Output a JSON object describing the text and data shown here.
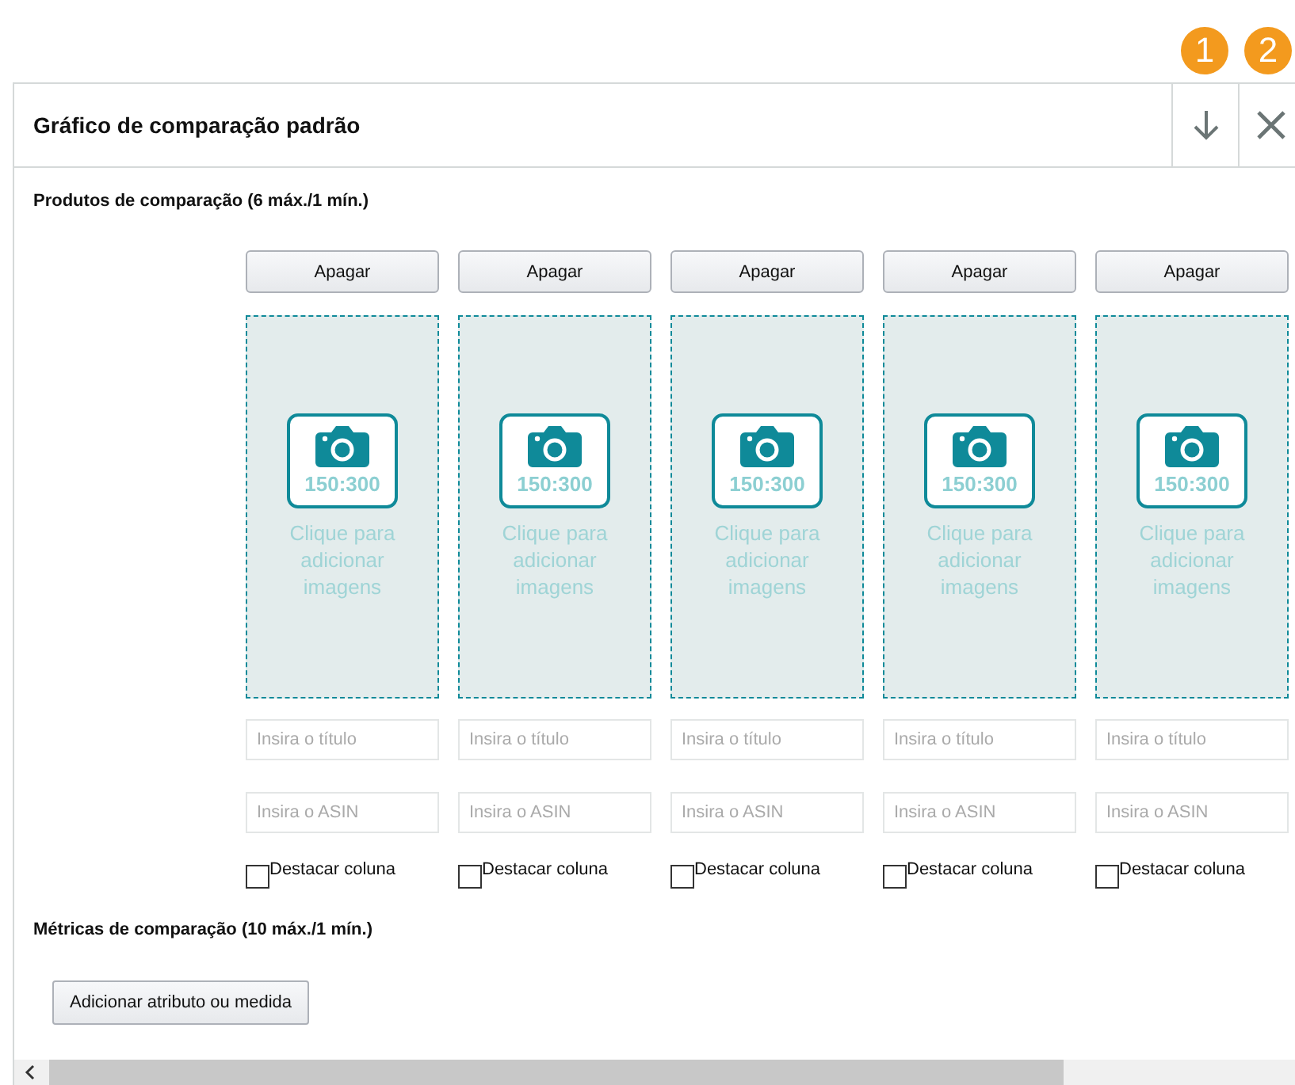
{
  "callouts": [
    "1",
    "2"
  ],
  "dialog": {
    "title": "Gráfico de comparação padrão"
  },
  "products_section": {
    "label": "Produtos de comparação (6 máx./1 mín.)"
  },
  "columns": [
    {
      "delete": "Apagar",
      "ratio": "150:300",
      "hint": "Clique para adicionar imagens",
      "title_placeholder": "Insira o título",
      "asin_placeholder": "Insira o ASIN",
      "highlight": "Destacar coluna",
      "checked": false
    },
    {
      "delete": "Apagar",
      "ratio": "150:300",
      "hint": "Clique para adicionar imagens",
      "title_placeholder": "Insira o título",
      "asin_placeholder": "Insira o ASIN",
      "highlight": "Destacar coluna",
      "checked": false
    },
    {
      "delete": "Apagar",
      "ratio": "150:300",
      "hint": "Clique para adicionar imagens",
      "title_placeholder": "Insira o título",
      "asin_placeholder": "Insira o ASIN",
      "highlight": "Destacar coluna",
      "checked": false
    },
    {
      "delete": "Apagar",
      "ratio": "150:300",
      "hint": "Clique para adicionar imagens",
      "title_placeholder": "Insira o título",
      "asin_placeholder": "Insira o ASIN",
      "highlight": "Destacar coluna",
      "checked": false
    },
    {
      "delete": "Apagar",
      "ratio": "150:300",
      "hint": "Clique para adicionar imagens",
      "title_placeholder": "Insira o título",
      "asin_placeholder": "Insira o ASIN",
      "highlight": "Destacar coluna",
      "checked": false
    }
  ],
  "metrics_section": {
    "label": "Métricas de comparação (10 máx./1 mín.)",
    "add_button": "Adicionar atributo ou medida"
  }
}
